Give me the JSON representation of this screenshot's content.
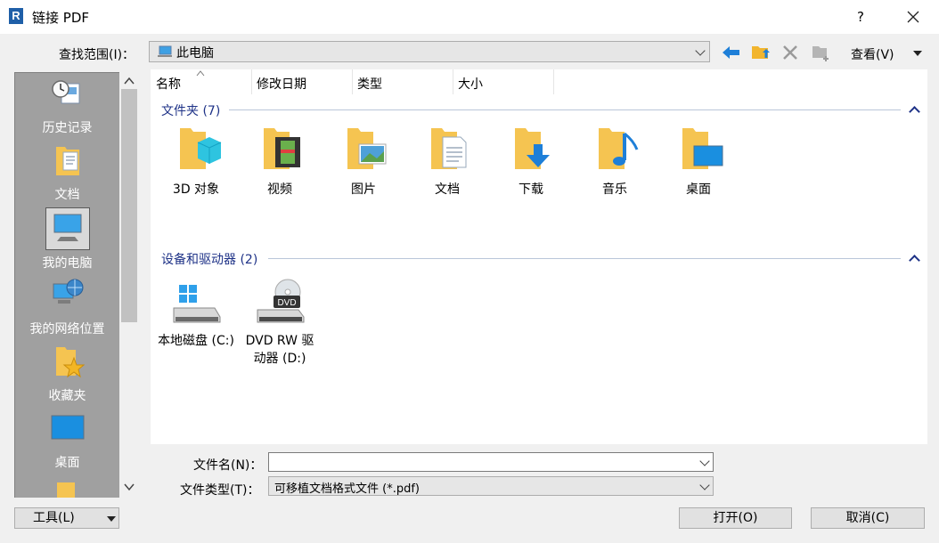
{
  "window": {
    "title": "链接 PDF",
    "app_icon_letter": "R",
    "help_label": "?"
  },
  "lookin": {
    "label": "查找范围(I)：",
    "value": "此电脑"
  },
  "toolbar": {
    "view_label": "查看(V)"
  },
  "places": [
    {
      "label": "历史记录",
      "icon": "history-icon"
    },
    {
      "label": "文档",
      "icon": "documents-icon"
    },
    {
      "label": "我的电脑",
      "icon": "computer-icon",
      "selected": true
    },
    {
      "label": "我的网络位置",
      "icon": "network-icon"
    },
    {
      "label": "收藏夹",
      "icon": "favorites-icon"
    },
    {
      "label": "桌面",
      "icon": "desktop-icon"
    }
  ],
  "columns": [
    "名称",
    "修改日期",
    "类型",
    "大小"
  ],
  "groups": {
    "folders": {
      "title": "文件夹 (7)",
      "items": [
        {
          "label": "3D 对象",
          "icon": "3d-objects-icon"
        },
        {
          "label": "视频",
          "icon": "videos-icon"
        },
        {
          "label": "图片",
          "icon": "pictures-icon"
        },
        {
          "label": "文档",
          "icon": "documents-icon"
        },
        {
          "label": "下载",
          "icon": "downloads-icon"
        },
        {
          "label": "音乐",
          "icon": "music-icon"
        },
        {
          "label": "桌面",
          "icon": "desktop-icon"
        }
      ]
    },
    "devices": {
      "title": "设备和驱动器 (2)",
      "items": [
        {
          "label": "本地磁盘 (C:)",
          "icon": "local-disk-icon"
        },
        {
          "label": "DVD RW 驱动器 (D:)",
          "line1": "DVD RW 驱",
          "line2": "动器 (D:)",
          "icon": "dvd-drive-icon",
          "badge": "DVD"
        }
      ]
    }
  },
  "filename": {
    "label": "文件名(N)：",
    "value": ""
  },
  "filetype": {
    "label": "文件类型(T)：",
    "value": "可移植文档格式文件 (*.pdf)"
  },
  "buttons": {
    "tools": "工具(L)",
    "open": "打开(O)",
    "cancel": "取消(C)"
  }
}
